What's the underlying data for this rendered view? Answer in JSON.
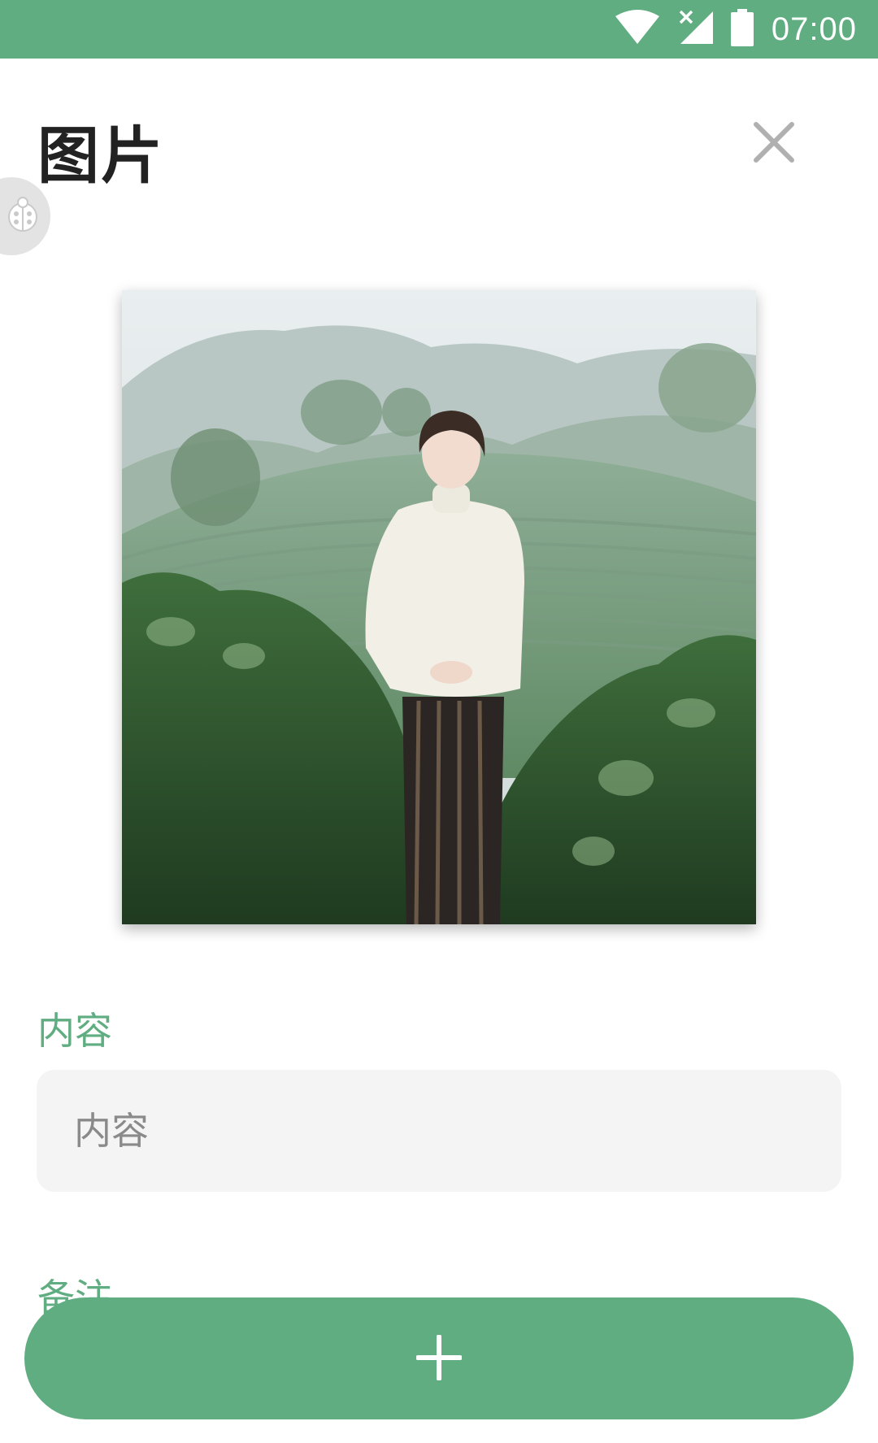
{
  "status_bar": {
    "time": "07:00",
    "icons": [
      "wifi-icon",
      "no-signal-icon",
      "battery-icon"
    ]
  },
  "header": {
    "title": "图片",
    "close_icon": "close-icon"
  },
  "debug_bubble_icon": "ladybug-icon",
  "photo": {
    "description_icon": "photo"
  },
  "form": {
    "content_label": "内容",
    "content_placeholder": "内容",
    "content_value": "",
    "note_label": "备注"
  },
  "fab": {
    "icon": "plus-icon"
  },
  "colors": {
    "accent": "#5fad80",
    "input_bg": "#f4f4f4",
    "title": "#222222"
  }
}
